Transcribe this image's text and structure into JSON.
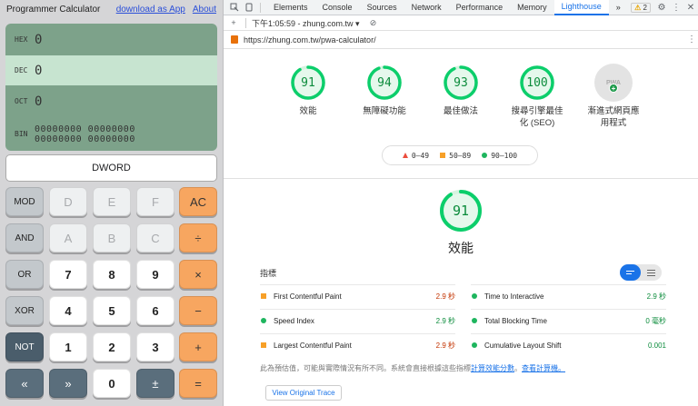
{
  "calculator": {
    "title": "Programmer Calculator",
    "download_link": "download as App",
    "about_link": "About",
    "display": {
      "hex": {
        "label": "HEX",
        "value": "0"
      },
      "dec": {
        "label": "DEC",
        "value": "0"
      },
      "oct": {
        "label": "OCT",
        "value": "0"
      },
      "bin": {
        "label": "BIN",
        "value": "00000000 00000000\n00000000 00000000"
      }
    },
    "word_size": "DWORD",
    "keys": [
      [
        "MOD",
        "D",
        "E",
        "F",
        "AC"
      ],
      [
        "AND",
        "A",
        "B",
        "C",
        "÷"
      ],
      [
        "OR",
        "7",
        "8",
        "9",
        "×"
      ],
      [
        "XOR",
        "4",
        "5",
        "6",
        "−"
      ],
      [
        "NOT",
        "1",
        "2",
        "3",
        "+"
      ],
      [
        "«",
        "»",
        "0",
        "±",
        "="
      ]
    ]
  },
  "devtools": {
    "tabs": [
      "Elements",
      "Console",
      "Sources",
      "Network",
      "Performance",
      "Memory",
      "Lighthouse"
    ],
    "active_tab": "Lighthouse",
    "more_tabs": "»",
    "warning_count": "2",
    "report_time": "下午1:05:59 - zhung.com.tw ▾",
    "url": "https://zhung.com.tw/pwa-calculator/",
    "categories": [
      {
        "score": 91,
        "label": "效能"
      },
      {
        "score": 94,
        "label": "無障礙功能"
      },
      {
        "score": 93,
        "label": "最佳做法"
      },
      {
        "score": 100,
        "label": "搜尋引擎最佳化 (SEO)"
      }
    ],
    "pwa": {
      "badge": "PWA",
      "label": "漸進式網頁應用程式"
    },
    "legend": [
      {
        "shape": "triangle",
        "range": "0–49"
      },
      {
        "shape": "square",
        "range": "50–89"
      },
      {
        "shape": "circle",
        "range": "90–100"
      }
    ],
    "performance": {
      "score": 91,
      "title": "效能"
    },
    "metrics_header": "指標",
    "metrics_left": [
      {
        "name": "First Contentful Paint",
        "value": "2.9 秒",
        "rating": "orange"
      },
      {
        "name": "Speed Index",
        "value": "2.9 秒",
        "rating": "green"
      },
      {
        "name": "Largest Contentful Paint",
        "value": "2.9 秒",
        "rating": "orange"
      }
    ],
    "metrics_right": [
      {
        "name": "Time to Interactive",
        "value": "2.9 秒",
        "rating": "green"
      },
      {
        "name": "Total Blocking Time",
        "value": "0 毫秒",
        "rating": "green"
      },
      {
        "name": "Cumulative Layout Shift",
        "value": "0.001",
        "rating": "green"
      }
    ],
    "note_text": "此為預估值，可能與實際情況有所不同。系統會直接根據這些指標",
    "note_link1": "計算效能分數",
    "note_mid": "。",
    "note_link2": "查看計算機。",
    "view_trace": "View Original Trace",
    "colors": {
      "green": "#0cce6b",
      "orange": "#ffa400",
      "red": "#ff4e42",
      "accent": "#1a73e8"
    }
  }
}
